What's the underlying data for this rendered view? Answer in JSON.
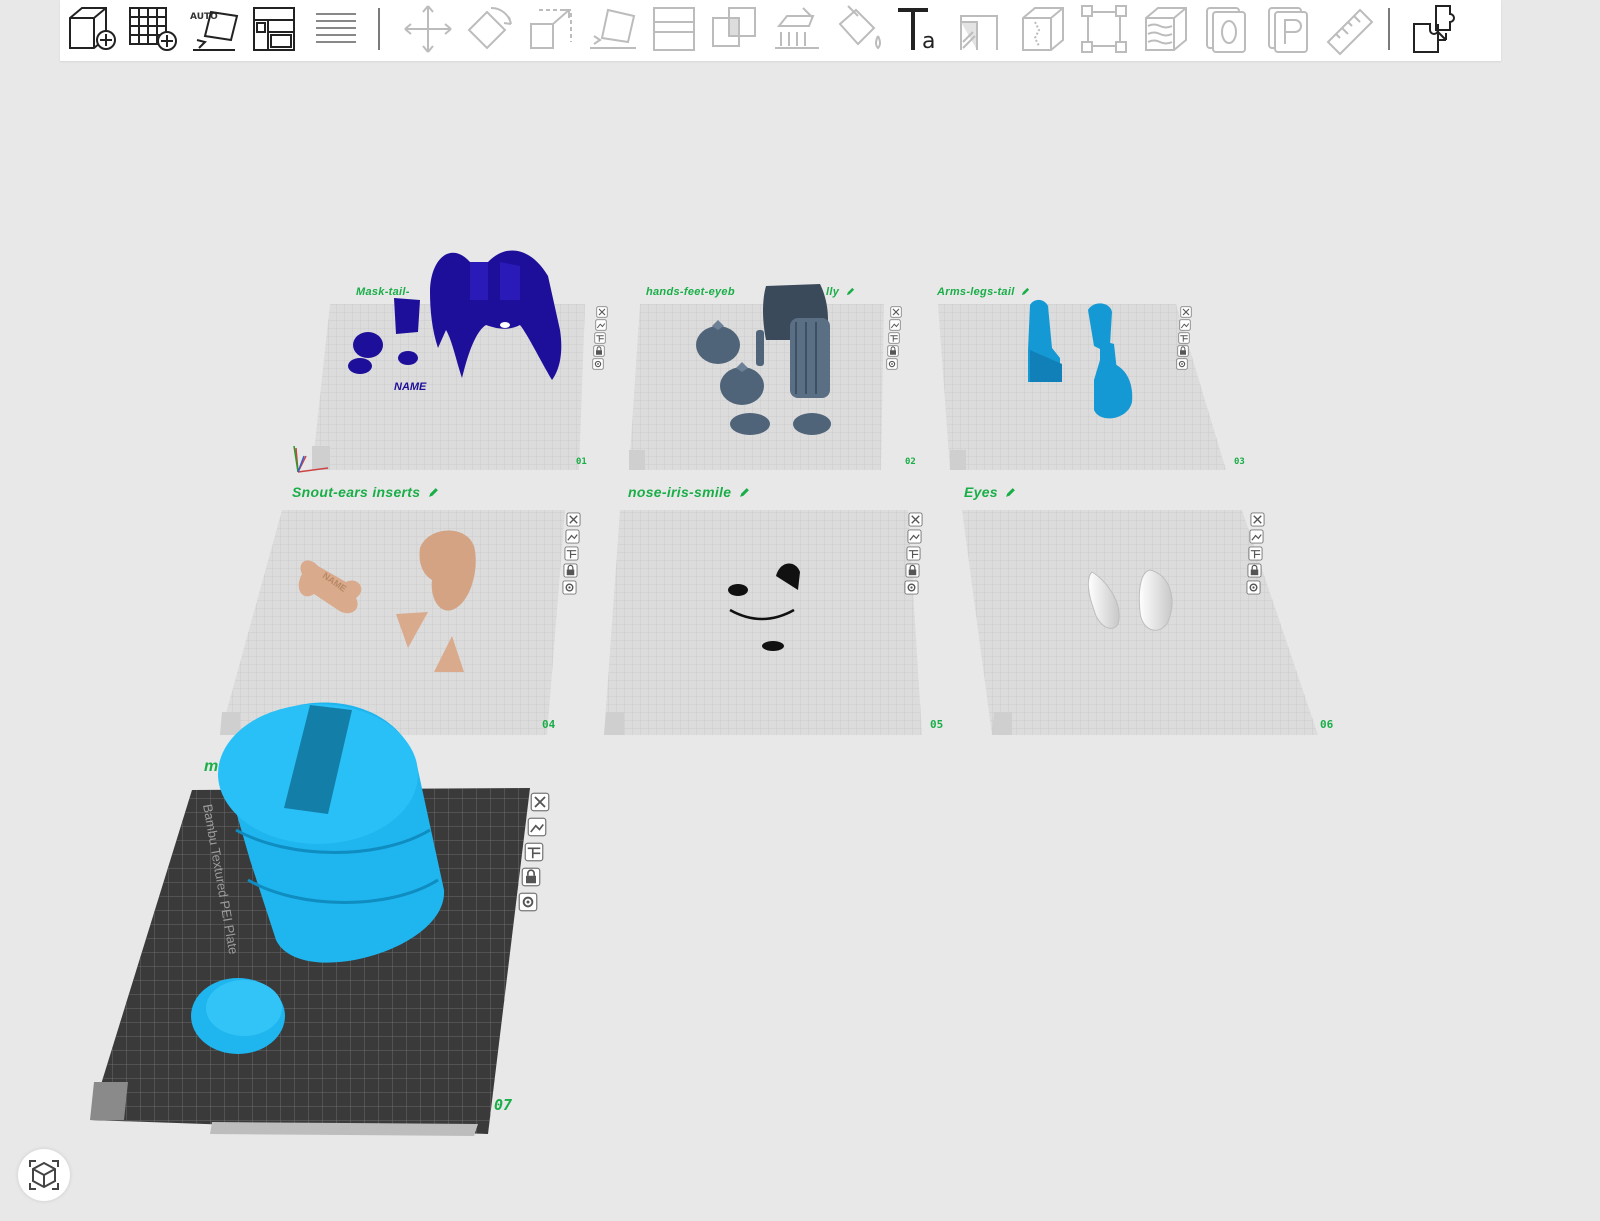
{
  "toolbar": {
    "auto_orient_text": "AUTO",
    "buttons": [
      {
        "id": "add-object",
        "enabled": true
      },
      {
        "id": "add-plate",
        "enabled": true
      },
      {
        "id": "auto-orient",
        "enabled": true
      },
      {
        "id": "arrange-all",
        "enabled": true
      },
      {
        "id": "split-menu",
        "enabled": true
      },
      {
        "id": "move",
        "enabled": false
      },
      {
        "id": "rotate",
        "enabled": false
      },
      {
        "id": "scale",
        "enabled": false
      },
      {
        "id": "lay-on-face",
        "enabled": false
      },
      {
        "id": "cut",
        "enabled": false
      },
      {
        "id": "boolean",
        "enabled": false
      },
      {
        "id": "support-paint",
        "enabled": false
      },
      {
        "id": "color-paint",
        "enabled": false
      },
      {
        "id": "text",
        "enabled": true
      },
      {
        "id": "fuzzy-skin",
        "enabled": false
      },
      {
        "id": "seam-paint",
        "enabled": false
      },
      {
        "id": "measure-box",
        "enabled": false
      },
      {
        "id": "variable-layer",
        "enabled": false
      },
      {
        "id": "split-objects",
        "enabled": false
      },
      {
        "id": "split-parts",
        "enabled": false
      },
      {
        "id": "measure",
        "enabled": false
      },
      {
        "id": "assembly",
        "enabled": true
      }
    ]
  },
  "plates": [
    {
      "label": "Mask-tail-",
      "number": "01"
    },
    {
      "label": "hands-feet-eyeb",
      "label_tail": "lly",
      "number": "02"
    },
    {
      "label": "Arms-legs-tail",
      "number": "03"
    },
    {
      "label": "Snout-ears inserts",
      "number": "04"
    },
    {
      "label": "nose-iris-smile",
      "number": "05"
    },
    {
      "label": "Eyes",
      "number": "06"
    },
    {
      "label": "m",
      "number": "07"
    }
  ],
  "plate_text": {
    "name_tag": "NAME",
    "bone_tag": "NAME",
    "bed_name": "Bambu Textured PEI Plate"
  },
  "colors": {
    "accent_green": "#19ae47",
    "mask_navy": "#1e0f9a",
    "slate_gray": "#4f6478",
    "arm_blue": "#1599d4",
    "tan": "#d9aa8c",
    "cyan": "#1fb5ee",
    "dark_plate": "#3a3a3a"
  }
}
